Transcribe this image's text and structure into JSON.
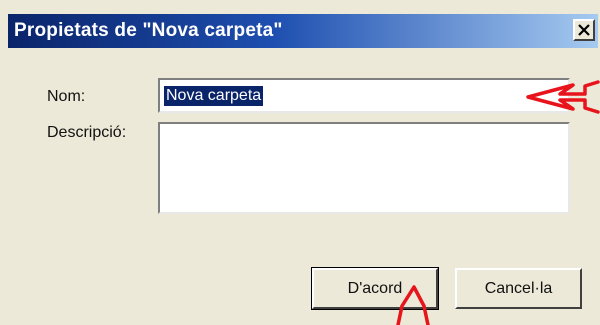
{
  "window": {
    "title": "Propietats de \"Nova carpeta\"",
    "close_label": "×"
  },
  "form": {
    "name_label": "Nom:",
    "name_value": "Nova carpeta",
    "description_label": "Descripció:",
    "description_value": ""
  },
  "buttons": {
    "ok_label": "D'acord",
    "cancel_label": "Cancel·la"
  },
  "annotations": {
    "arrow_color": "#e8141c",
    "name_arrow_icon": "red-arrow-left-icon",
    "ok_arrow_icon": "red-arrow-up-icon"
  },
  "colors": {
    "titlebar_start": "#0a246a",
    "titlebar_end": "#a6caf0",
    "dialog_background": "#ece9d8",
    "selection": "#0a246a"
  }
}
